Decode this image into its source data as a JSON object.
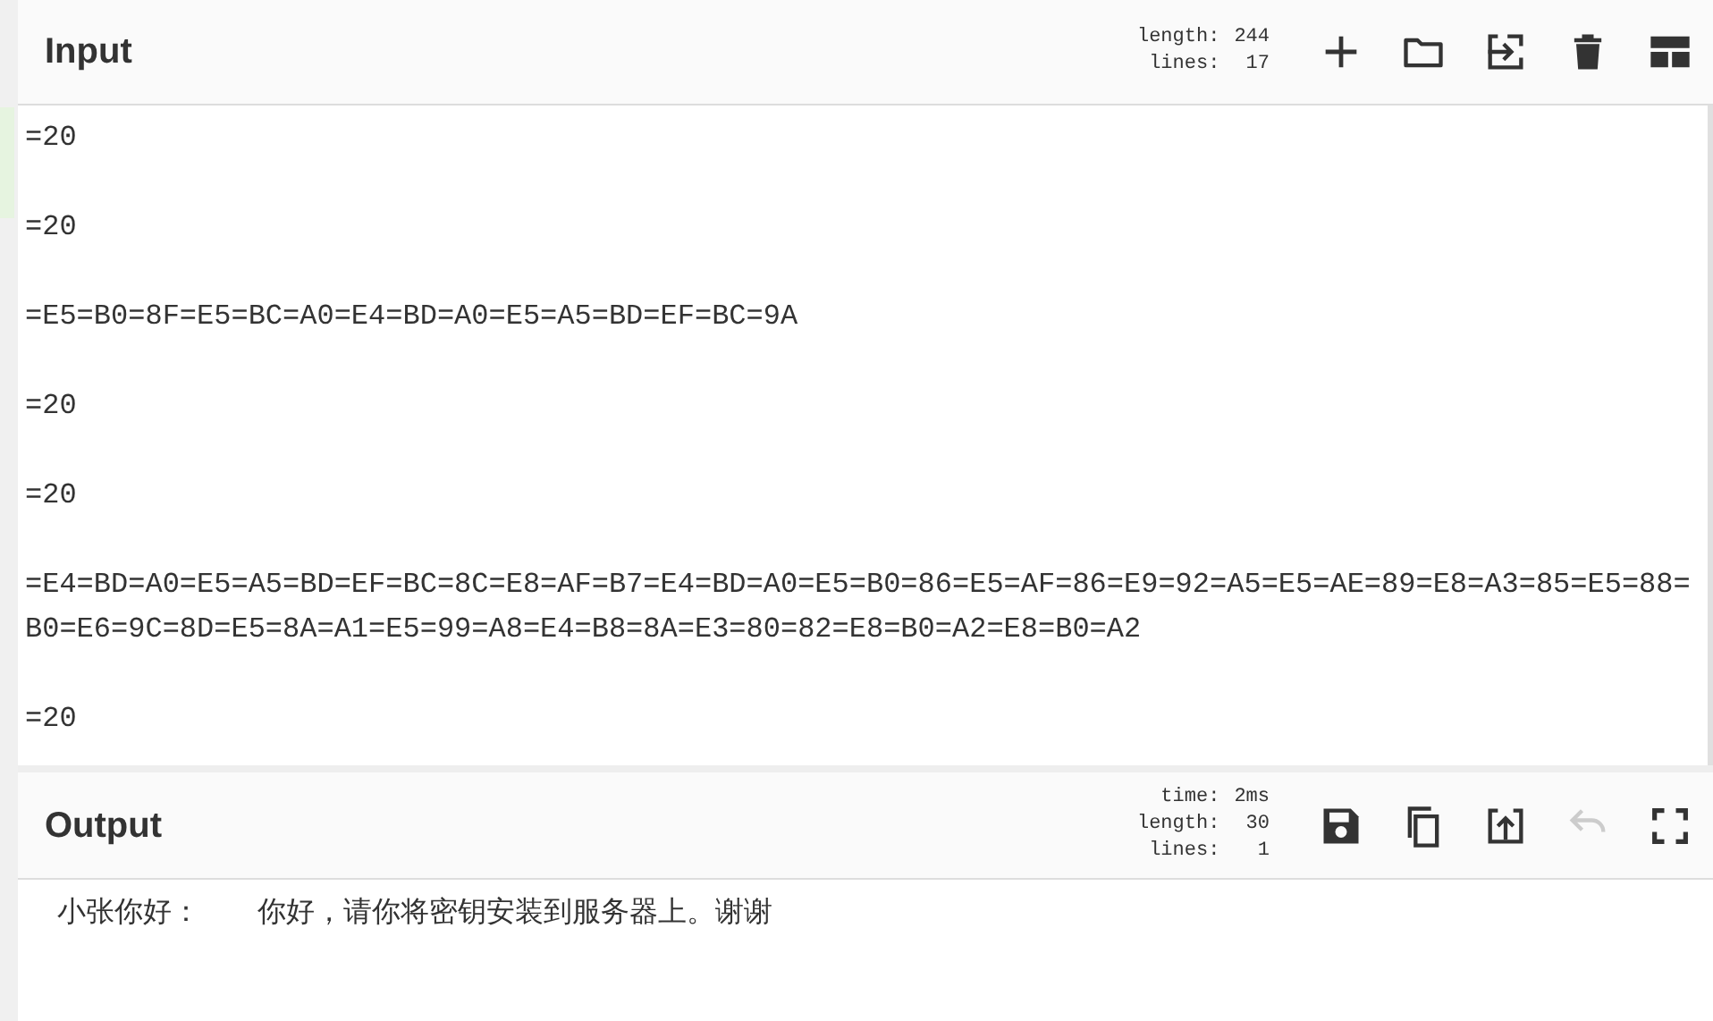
{
  "input": {
    "title": "Input",
    "stats": [
      {
        "label": "length:",
        "value": "244"
      },
      {
        "label": "lines:",
        "value": "17"
      }
    ],
    "buttons": [
      {
        "kind": "plus",
        "disabled": false
      },
      {
        "kind": "folder",
        "disabled": false
      },
      {
        "kind": "import",
        "disabled": false
      },
      {
        "kind": "trash",
        "disabled": false
      },
      {
        "kind": "layout",
        "disabled": false
      }
    ],
    "lines": [
      "=20",
      "=20",
      "=E5=B0=8F=E5=BC=A0=E4=BD=A0=E5=A5=BD=EF=BC=9A",
      "=20",
      "=20",
      "=E4=BD=A0=E5=A5=BD=EF=BC=8C=E8=AF=B7=E4=BD=A0=E5=B0=86=E5=AF=86=E9=92=A5=E5=AE=89=E8=A3=85=E5=88=B0=E6=9C=8D=E5=8A=A1=E5=99=A8=E4=B8=8A=E3=80=82=E8=B0=A2=E8=B0=A2",
      "=20"
    ]
  },
  "output": {
    "title": "Output",
    "stats": [
      {
        "label": "time:",
        "value": "2ms"
      },
      {
        "label": "length:",
        "value": "30"
      },
      {
        "label": "lines:",
        "value": "1"
      }
    ],
    "buttons": [
      {
        "kind": "save",
        "disabled": false
      },
      {
        "kind": "copy",
        "disabled": false
      },
      {
        "kind": "replace-input",
        "disabled": false
      },
      {
        "kind": "undo",
        "disabled": true
      },
      {
        "kind": "fullscreen",
        "disabled": false
      }
    ],
    "text": "小张你好：　　你好，请你将密钥安装到服务器上。谢谢"
  }
}
